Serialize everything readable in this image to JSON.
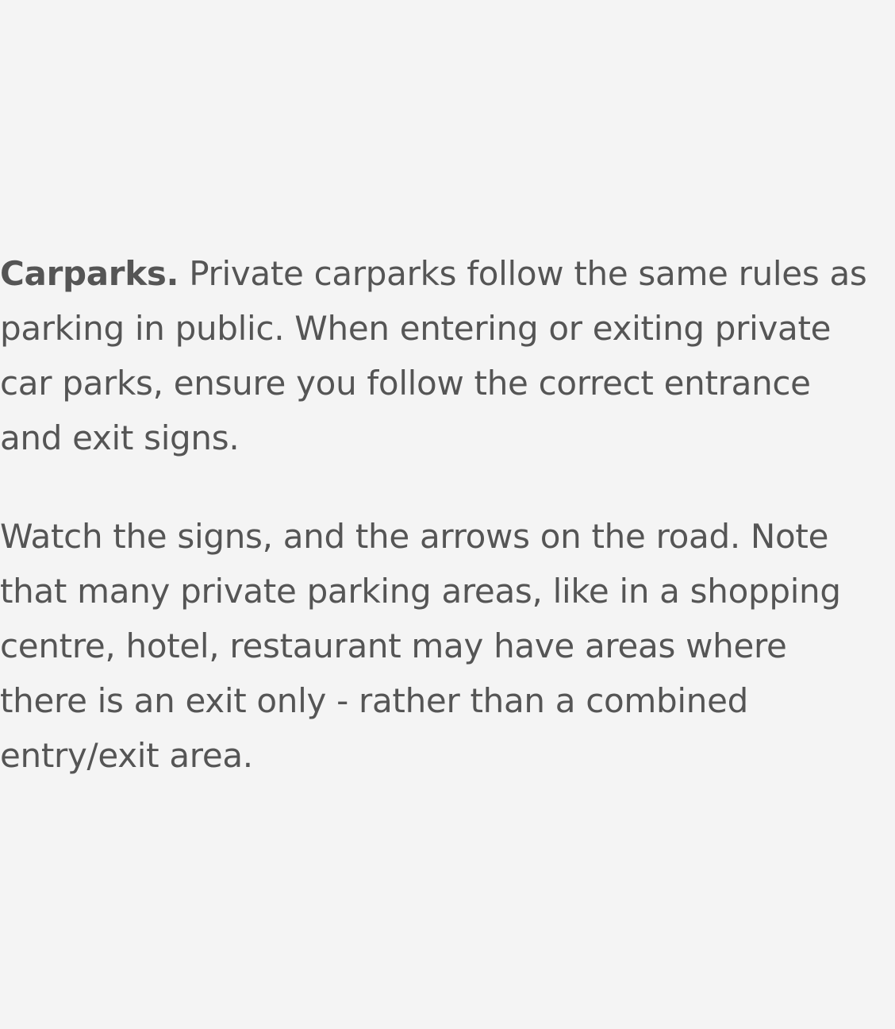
{
  "article": {
    "paragraph1": {
      "lead": "Carparks.",
      "text": " Private carparks follow the same rules as parking in public. When entering or exiting private car parks, ensure you follow the correct entrance and exit signs."
    },
    "paragraph2": {
      "text": "Watch the signs, and the arrows on the road. Note that many private parking areas, like in a shopping centre, hotel, restaurant may have areas where there is an exit only - rather than a combined entry/exit area."
    }
  },
  "colors": {
    "background": "#f4f4f4",
    "text": "#555555"
  }
}
